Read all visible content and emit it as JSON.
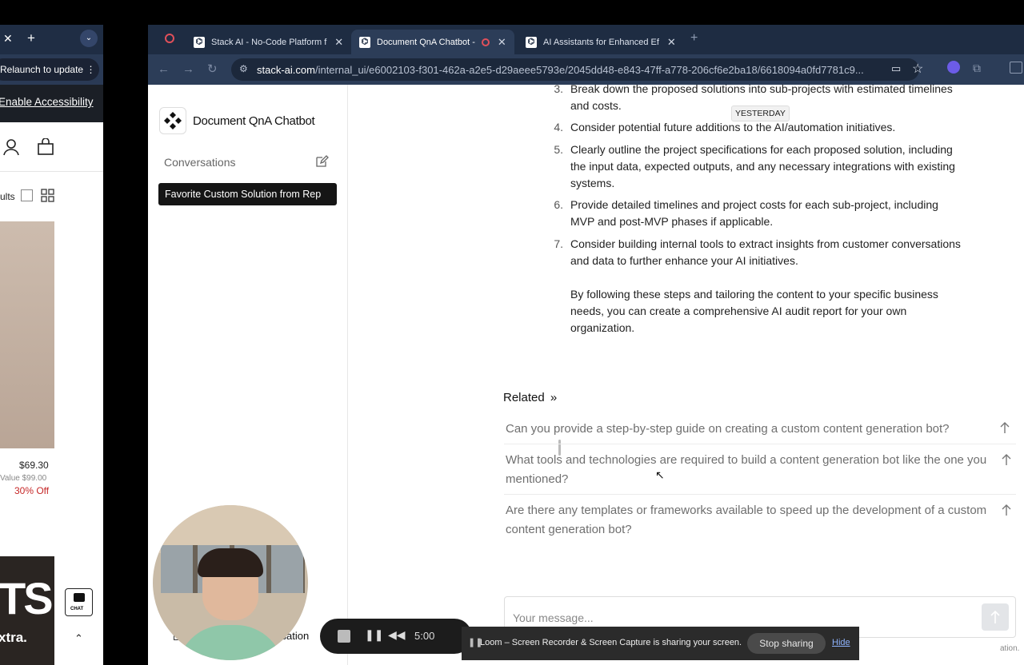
{
  "left_window": {
    "relaunch_label": "Relaunch to update",
    "accessibility_link": "Enable Accessibility",
    "results_text": "ults",
    "price": "$69.30",
    "value_text": "Value $99.00",
    "discount": "30% Off",
    "banner_text_1": "TS",
    "banner_text_2": "xtra.",
    "chat_label": "CHAT"
  },
  "browser": {
    "tabs": [
      {
        "label": "Stack AI - No-Code Platform f"
      },
      {
        "label": "Document QnA Chatbot -"
      },
      {
        "label": "AI Assistants for Enhanced Ef"
      }
    ],
    "url_domain": "stack-ai.com",
    "url_path": "/internal_ui/e6002103-f301-462a-a2e5-d29aeee5793e/2045dd48-e843-47ff-a778-206cf6e2ba18/6618094a0fd7781c9..."
  },
  "sidebar": {
    "app_title": "Document QnA Chatbot",
    "conversations_label": "Conversations",
    "conversation_item": "Favorite Custom Solution from Rep"
  },
  "chat": {
    "yesterday_tooltip": "YESTERDAY",
    "steps": [
      {
        "num": "3.",
        "text": "Break down the proposed solutions into sub-projects with estimated timelines and costs."
      },
      {
        "num": "4.",
        "text": "Consider potential future additions to the AI/automation initiatives."
      },
      {
        "num": "5.",
        "text": "Clearly outline the project specifications for each proposed solution, including the input data, expected outputs, and any necessary integrations with existing systems."
      },
      {
        "num": "6.",
        "text": "Provide detailed timelines and project costs for each sub-project, including MVP and post-MVP phases if applicable."
      },
      {
        "num": "7.",
        "text": "Consider building internal tools to extract insights from customer conversations and data to further enhance your AI initiatives."
      }
    ],
    "closing": "By following these steps and tailoring the content to your specific business needs, you can create a comprehensive AI audit report for your own organization.",
    "related_title": "Related",
    "related_questions": [
      "Can you provide a step-by-step guide on creating a custom content generation bot?",
      "What tools and technologies are required to build a content generation bot like the one you mentioned?",
      "Are there any templates or frameworks available to speed up the development of a custom content generation bot?"
    ],
    "message_placeholder": "Your message...",
    "footer_fragment": "ation."
  },
  "overlays": {
    "new_conversation_fragment": "ersation",
    "loom_timer": "5:00",
    "share_message": "Loom – Screen Recorder & Screen Capture is sharing your screen.",
    "stop_sharing_label": "Stop sharing",
    "hide_label": "Hide"
  }
}
